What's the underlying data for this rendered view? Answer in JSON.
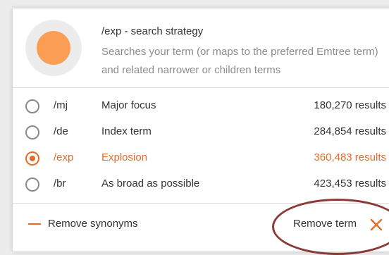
{
  "header": {
    "title": "/exp - search strategy",
    "description": "Searches your term (or maps to the preferred Emtree term) and related narrower or children terms",
    "icon": "search-strategy-icon",
    "icon_color": "#fb9d52"
  },
  "options": [
    {
      "code": "/mj",
      "label": "Major focus",
      "count": "180,270 results",
      "selected": false
    },
    {
      "code": "/de",
      "label": "Index term",
      "count": "284,854 results",
      "selected": false
    },
    {
      "code": "/exp",
      "label": "Explosion",
      "count": "360,483 results",
      "selected": true
    },
    {
      "code": "/br",
      "label": "As broad as possible",
      "count": "423,453 results",
      "selected": false
    }
  ],
  "footer": {
    "remove_synonyms_label": "Remove synonyms",
    "remove_term_label": "Remove term"
  },
  "colors": {
    "accent": "#e46c2c",
    "annotation": "#8b3a3a"
  }
}
